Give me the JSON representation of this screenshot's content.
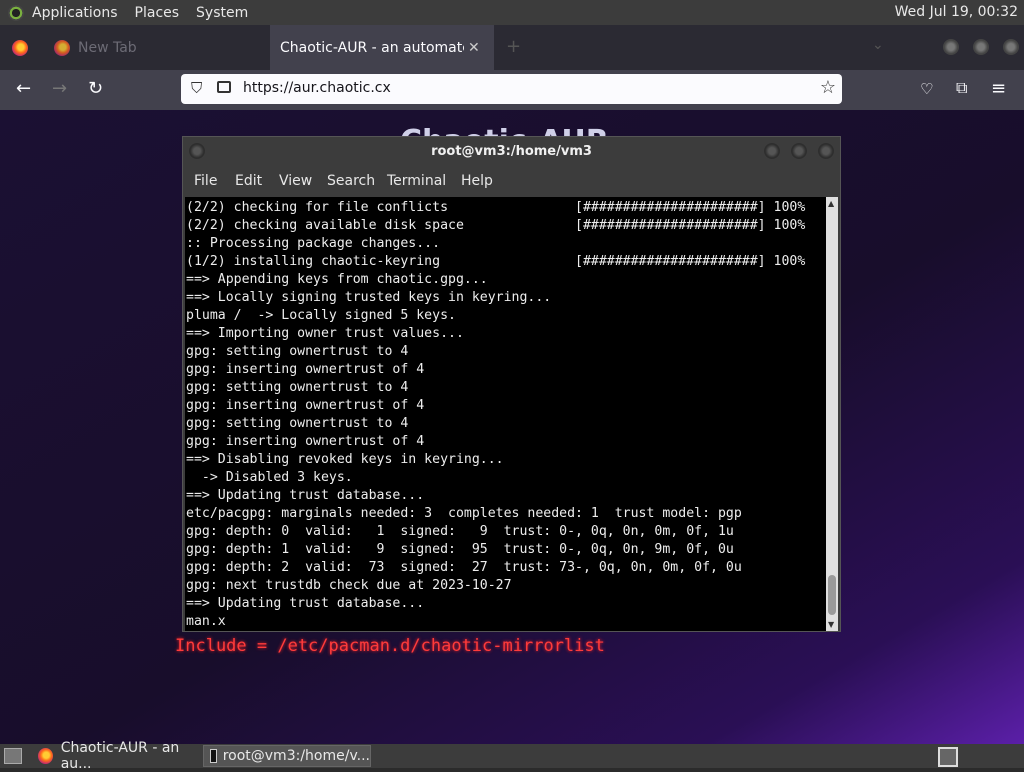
{
  "panel": {
    "menus": [
      "Applications",
      "Places",
      "System"
    ],
    "clock": "Wed Jul 19, 00:32"
  },
  "browser": {
    "tabs": [
      {
        "label": "New Tab",
        "active": false
      },
      {
        "label": "Chaotic-AUR - an automated bu",
        "active": true
      }
    ],
    "url": "https://aur.chaotic.cx"
  },
  "page": {
    "heading": "Chaotic-AUR",
    "include_line": "Include = /etc/pacman.d/chaotic-mirrorlist"
  },
  "terminal": {
    "title": "root@vm3:/home/vm3",
    "menu": [
      "File",
      "Edit",
      "View",
      "Search",
      "Terminal",
      "Help"
    ],
    "lines": [
      "(2/2) checking for file conflicts                [######################] 100%",
      "(2/2) checking available disk space              [######################] 100%",
      ":: Processing package changes...",
      "(1/2) installing chaotic-keyring                 [######################] 100%",
      "==> Appending keys from chaotic.gpg...",
      "==> Locally signing trusted keys in keyring...",
      "pluma /  -> Locally signed 5 keys.",
      "==> Importing owner trust values...",
      "gpg: setting ownertrust to 4",
      "gpg: inserting ownertrust of 4",
      "gpg: setting ownertrust to 4",
      "gpg: inserting ownertrust of 4",
      "gpg: setting ownertrust to 4",
      "gpg: inserting ownertrust of 4",
      "==> Disabling revoked keys in keyring...",
      "  -> Disabled 3 keys.",
      "==> Updating trust database...",
      "etc/pacgpg: marginals needed: 3  completes needed: 1  trust model: pgp",
      "gpg: depth: 0  valid:   1  signed:   9  trust: 0-, 0q, 0n, 0m, 0f, 1u",
      "gpg: depth: 1  valid:   9  signed:  95  trust: 0-, 0q, 0n, 9m, 0f, 0u",
      "gpg: depth: 2  valid:  73  signed:  27  trust: 73-, 0q, 0n, 0m, 0f, 0u",
      "gpg: next trustdb check due at 2023-10-27",
      "==> Updating trust database...",
      "man.x"
    ]
  },
  "taskbar": {
    "tasks": [
      {
        "label": "Chaotic-AUR - an au...",
        "active": false
      },
      {
        "label": "root@vm3:/home/v...",
        "active": true
      }
    ]
  }
}
